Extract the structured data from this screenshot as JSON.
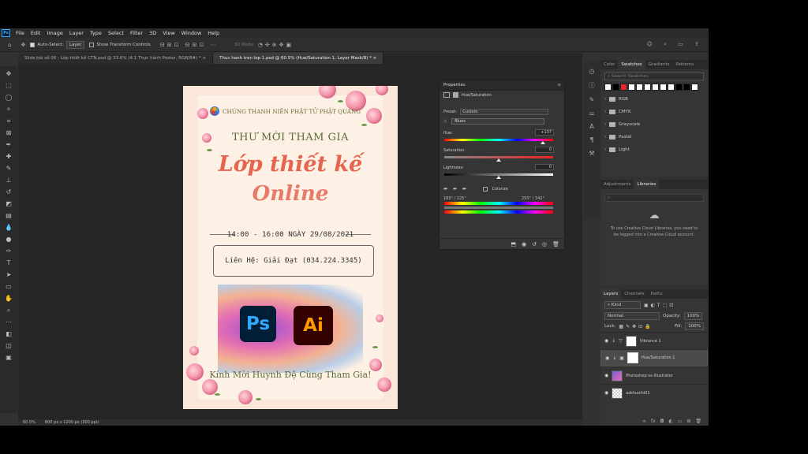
{
  "menu": {
    "app_badge": "Ps",
    "items": [
      "File",
      "Edit",
      "Image",
      "Layer",
      "Type",
      "Select",
      "Filter",
      "3D",
      "View",
      "Window",
      "Help"
    ]
  },
  "options": {
    "auto_select": "Auto-Select:",
    "layer_mode": "Layer",
    "show_transform": "Show Transform Controls",
    "mode_3d": "3D Mode:"
  },
  "tabs": [
    {
      "label": "Slide bài số 06 - Lớp thiết kế CTN.psd @ 33.6% (4.1 Thực hành Poster, RGB/8#) *",
      "active": false
    },
    {
      "label": "Thuc hanh tren lop 1.psd @ 60.5% (Hue/Saturation 1, Layer Mask/8) *",
      "active": true
    }
  ],
  "poster": {
    "header": "CHÚNG THANH NIÊN PHẬT TỬ PHẬT QUANG",
    "invite": "THƯ MỜI THAM GIA",
    "title_line1": "Lớp thiết kế",
    "title_line2": "Online",
    "time": "14:00 - 16:00 NGÀY 29/08/2021",
    "contact": "Liên Hệ: Giải Đạt (034.224.3345)",
    "ps_label": "Ps",
    "ai_label": "Ai",
    "footer": "Kính Mời Huynh Đệ Cùng Tham Gia!"
  },
  "properties": {
    "title": "Properties",
    "adjustment": "Hue/Saturation",
    "preset_label": "Preset:",
    "preset_value": "Custom",
    "channel": "Blues",
    "hue_label": "Hue:",
    "hue_value": "+137",
    "saturation_label": "Saturation:",
    "saturation_value": "0",
    "lightness_label": "Lightness:",
    "lightness_value": "0",
    "colorize_label": "Colorize",
    "range_left": "183° / 225°",
    "range_right": "255° \\ 342°"
  },
  "swatches_panel": {
    "tabs": [
      "Color",
      "Swatches",
      "Gradients",
      "Patterns"
    ],
    "active_tab": "Swatches",
    "search_placeholder": "Search Swatches",
    "colors": [
      "#ffffff",
      "#000000",
      "#e8262b",
      "#ffffff",
      "#ffffff",
      "#ffffff",
      "#ffffff",
      "#ffffff",
      "#ffffff",
      "#000000",
      "#000000",
      "#ffffff"
    ],
    "folders": [
      "RGB",
      "CMYK",
      "Grayscale",
      "Pastel",
      "Light"
    ]
  },
  "libraries_panel": {
    "tabs": [
      "Adjustments",
      "Libraries"
    ],
    "active_tab": "Libraries",
    "message": "To use Creative Cloud Libraries, you need to be logged into a Creative Cloud account."
  },
  "layers_panel": {
    "tabs": [
      "Layers",
      "Channels",
      "Paths"
    ],
    "active_tab": "Layers",
    "kind": "Kind",
    "blend_mode": "Normal",
    "opacity_label": "Opacity:",
    "opacity": "100%",
    "lock_label": "Lock:",
    "fill_label": "Fill:",
    "fill": "100%",
    "layers": [
      {
        "name": "Vibrance 1",
        "selected": false
      },
      {
        "name": "Hue/Saturation 1",
        "selected": true
      },
      {
        "name": "Photoshop-vs-Illustrator",
        "selected": false
      },
      {
        "name": "askhuoihi01",
        "selected": false
      }
    ]
  },
  "status": {
    "zoom": "60.5%",
    "doc_info": "800 px x 1200 px (300 ppi)"
  }
}
